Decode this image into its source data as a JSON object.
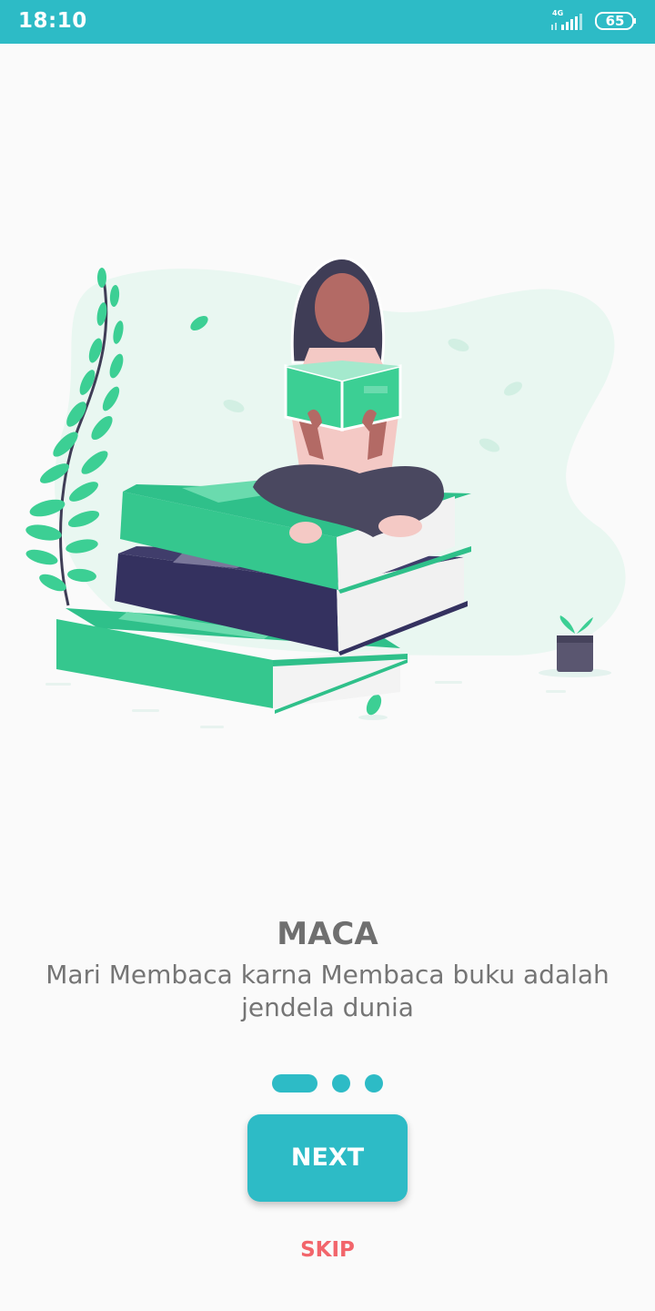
{
  "status_bar": {
    "time": "18:10",
    "network": "4G",
    "battery": "65",
    "signal_icon": "cellular-signal-icon",
    "battery_icon": "battery-icon",
    "background_color": "#2dbbc6"
  },
  "illustration": {
    "icon": "woman-reading-on-books-illustration"
  },
  "onboarding": {
    "title": "MACA",
    "subtitle": "Mari Membaca karna Membaca buku adalah jendela dunia",
    "page_count": 3,
    "active_page": 1
  },
  "actions": {
    "next_label": "NEXT",
    "skip_label": "SKIP"
  },
  "colors": {
    "accent": "#2dbbc6",
    "skip": "#f2656b",
    "text": "#757575",
    "book_green": "#3ccf94",
    "book_navy": "#33315f"
  }
}
